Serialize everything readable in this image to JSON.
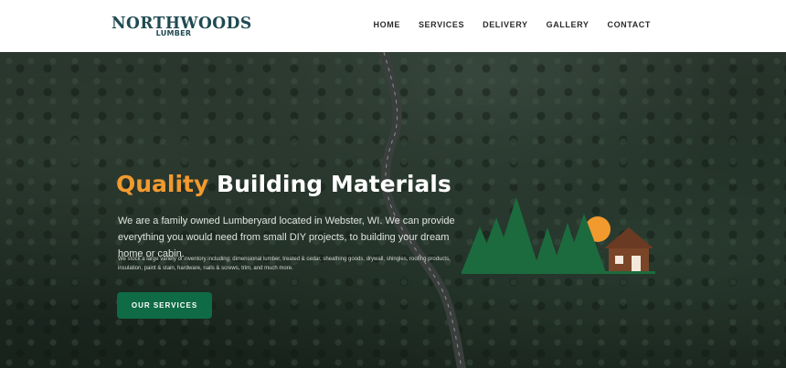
{
  "brand": {
    "logo_top": "NORTHWOODS",
    "logo_bottom": "LUMBER"
  },
  "nav": {
    "items": [
      {
        "label": "HOME"
      },
      {
        "label": "SERVICES"
      },
      {
        "label": "DELIVERY"
      },
      {
        "label": "GALLERY"
      },
      {
        "label": "CONTACT"
      }
    ]
  },
  "hero": {
    "title_accent": "Quality",
    "title_rest": " Building Materials",
    "lead": "We are a family owned Lumberyard located in Webster, WI. We can provide everything you would need from small DIY projects, to building your dream home or cabin.",
    "small": "We stock a large variety of inventory including: dimensional lumber, treated & cedar, sheathing goods, drywall, shingles, roofing products, insulation, paint & stain, hardware, nails & screws, trim, and much more.",
    "cta_label": "OUR SERVICES"
  },
  "colors": {
    "accent_orange": "#f29a2e",
    "brand_green": "#0e6b46",
    "logo_teal": "#1f4a52",
    "tree_green": "#1c6b3e",
    "cabin_brown": "#6b3a22"
  },
  "icons": {
    "illustration": "trees-cabin-sun-icon"
  }
}
